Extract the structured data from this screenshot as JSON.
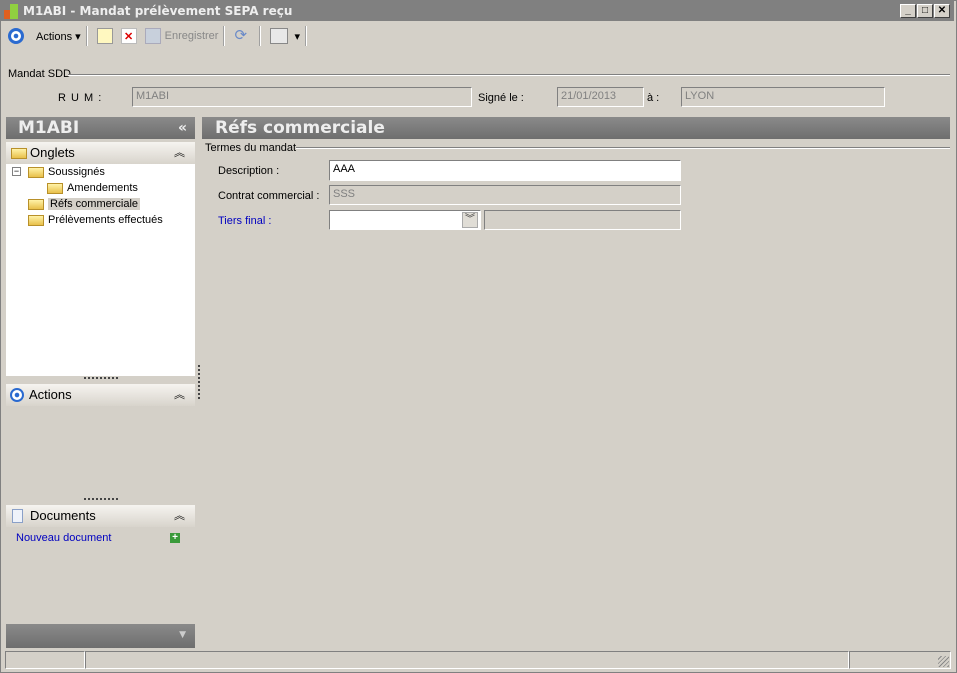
{
  "window": {
    "title": "M1ABI -  Mandat prélèvement SEPA reçu",
    "min": "_",
    "max": "□",
    "close": "✕"
  },
  "toolbar": {
    "actions": "Actions",
    "save": "Enregistrer"
  },
  "mandat": {
    "group": "Mandat SDD",
    "rum_label": "R U M :",
    "rum": "M1ABI",
    "signe_label": "Signé le :",
    "signe": "21/01/2013",
    "a_label": "à :",
    "a": "LYON"
  },
  "sidebar": {
    "title": "M1ABI",
    "collapse": "«",
    "onglets": "Onglets",
    "tree": [
      "Soussignés",
      "Amendements",
      "Réfs commerciale",
      "Prélèvements effectués"
    ],
    "actions": "Actions",
    "documents": "Documents",
    "nouveau": "Nouveau document",
    "expand_all": "⌃"
  },
  "main": {
    "title": "Réfs commerciale",
    "group": "Termes du mandat",
    "description_label": "Description :",
    "description": "AAA",
    "contrat_label": "Contrat commercial :",
    "contrat": "SSS",
    "tiers_label": "Tiers final :",
    "tiers": "",
    "tiers2": ""
  },
  "colors": {
    "header": "#7a7a7a",
    "link": "#0000c0"
  }
}
